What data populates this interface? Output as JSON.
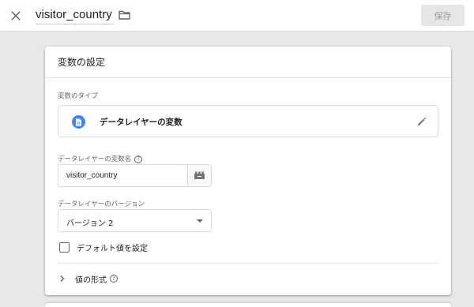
{
  "header": {
    "variable_name": "visitor_country",
    "save_label": "保存"
  },
  "card": {
    "title": "変数の設定",
    "type_section_label": "変数のタイプ",
    "type_name": "データレイヤーの変数",
    "dl_name_label": "データレイヤーの変数名",
    "dl_name_value": "visitor_country",
    "version_label": "データレイヤーのバージョン",
    "version_selected": "バージョン 2",
    "default_checkbox_label": "デフォルト値を設定",
    "default_checkbox_checked": false,
    "format_label": "値の形式"
  },
  "colors": {
    "accent": "#4285f4",
    "save_disabled_bg": "#e6e6e6"
  },
  "icons": [
    "close-icon",
    "folder-icon",
    "variable-doc-icon",
    "edit-icon",
    "help-icon",
    "variable-picker-icon",
    "chevron-right-icon",
    "dropdown-arrow-icon"
  ]
}
